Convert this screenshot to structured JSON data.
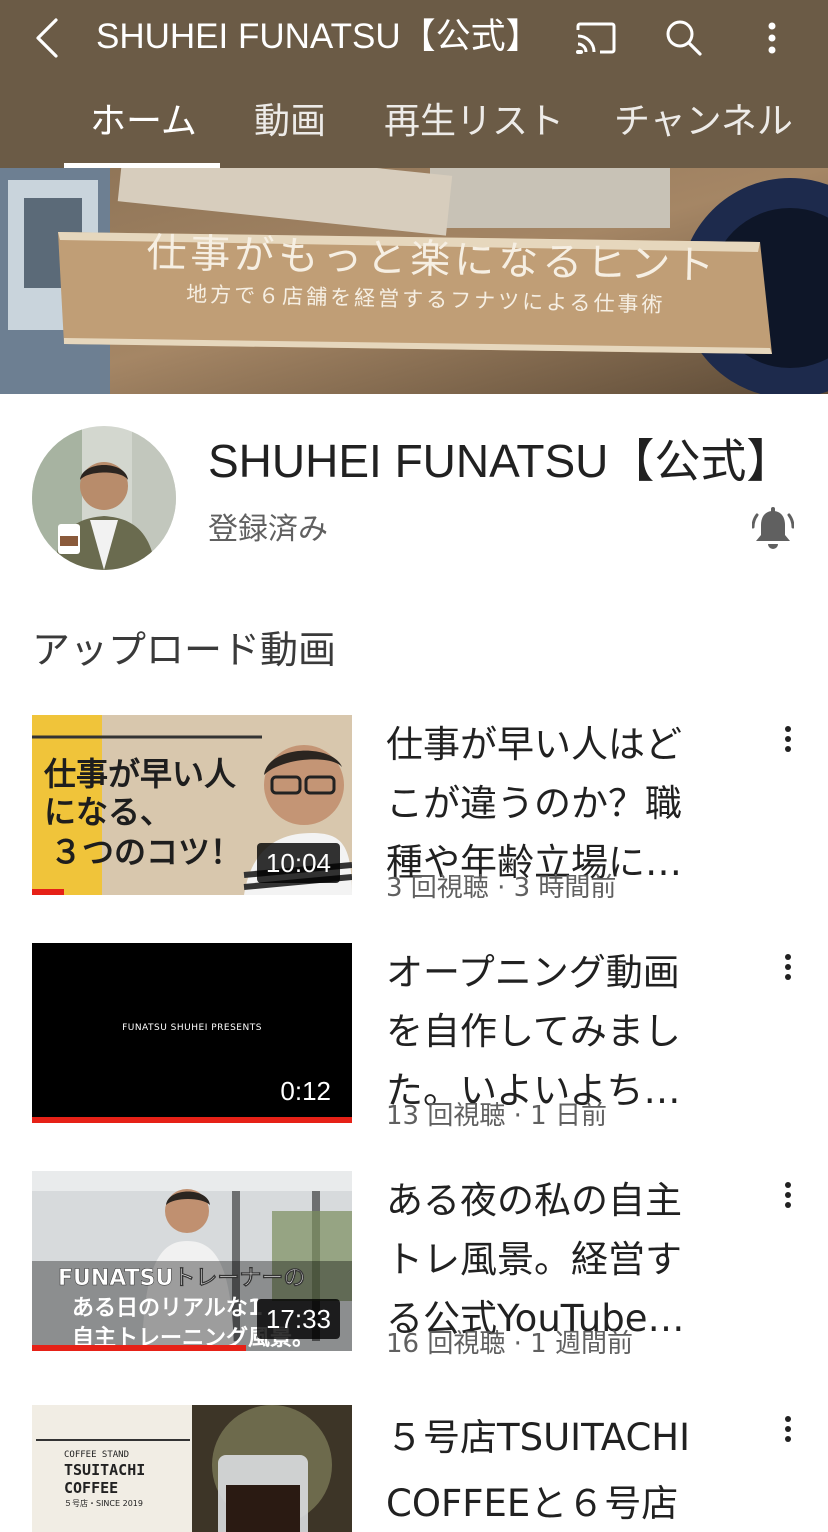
{
  "app": {
    "title": "SHUHEI FUNATSU【公式】",
    "accent_color": "#6b5b46",
    "icons": [
      "back-arrow-icon",
      "cast-icon",
      "search-icon",
      "more-vert-icon",
      "bell-icon"
    ]
  },
  "tabs": [
    {
      "label": "ホーム",
      "selected": true
    },
    {
      "label": "動画",
      "selected": false
    },
    {
      "label": "再生リスト",
      "selected": false
    },
    {
      "label": "チャンネル",
      "selected": false
    }
  ],
  "banner": {
    "headline": "仕事がもっと楽になるヒント",
    "subline": "地方で６店舗を経営するフナツによる仕事術"
  },
  "channel": {
    "name": "SHUHEI FUNATSU【公式】",
    "subscription_status": "登録済み"
  },
  "section": {
    "title": "アップロード動画"
  },
  "videos": [
    {
      "title": "仕事が早い人はどこが違うのか？職種や年齢立場に…",
      "meta": "3 回視聴 · 3 時間前",
      "duration": "10:04",
      "progress": 0.1,
      "thumb_text": "仕事が早い人になる、３つのコツ！"
    },
    {
      "title": "オープニング動画を自作してみました。いよいよち…",
      "meta": "13 回視聴 · 1 日前",
      "duration": "0:12",
      "progress": 1.0,
      "thumb_text": "FUNATSU SHUHEI PRESENTS"
    },
    {
      "title": "ある夜の私の自主トレ風景。経営する公式YouTube…",
      "meta": "16 回視聴 · 1 週間前",
      "duration": "17:33",
      "progress": 0.67,
      "thumb_text_line1": "FUNATSUトレーナーの",
      "thumb_text_line2": "ある日のリアルな1",
      "thumb_text_line3": "自主トレーニング風景。"
    },
    {
      "title": "５号店TSUITACHI COFFEEと６号店",
      "thumb_text_line1": "COFFEE STAND",
      "thumb_text_line2": "TSUITACHI",
      "thumb_text_line3": "COFFEE",
      "thumb_text_line4": "５号店・SINCE 2019"
    }
  ]
}
